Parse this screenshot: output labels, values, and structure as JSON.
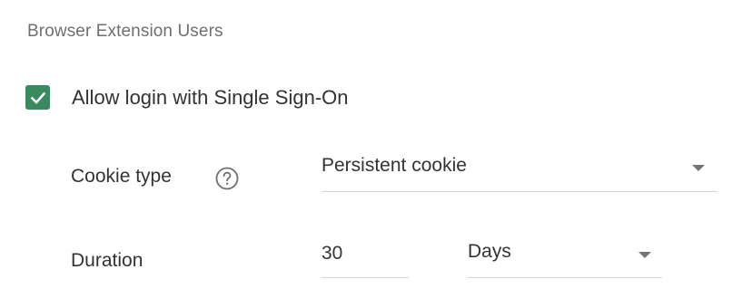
{
  "section": {
    "title": "Browser Extension Users"
  },
  "sso": {
    "checkbox_label": "Allow login with Single Sign-On",
    "checked": true
  },
  "cookie_type": {
    "label": "Cookie type",
    "help_icon": "help-circle-icon",
    "selected": "Persistent cookie"
  },
  "duration": {
    "label": "Duration",
    "value": "30",
    "unit_selected": "Days"
  },
  "colors": {
    "accent": "#3a8a5f",
    "section_title": "#6f6f6f",
    "text": "#333333",
    "underline": "#d6d6d6"
  }
}
